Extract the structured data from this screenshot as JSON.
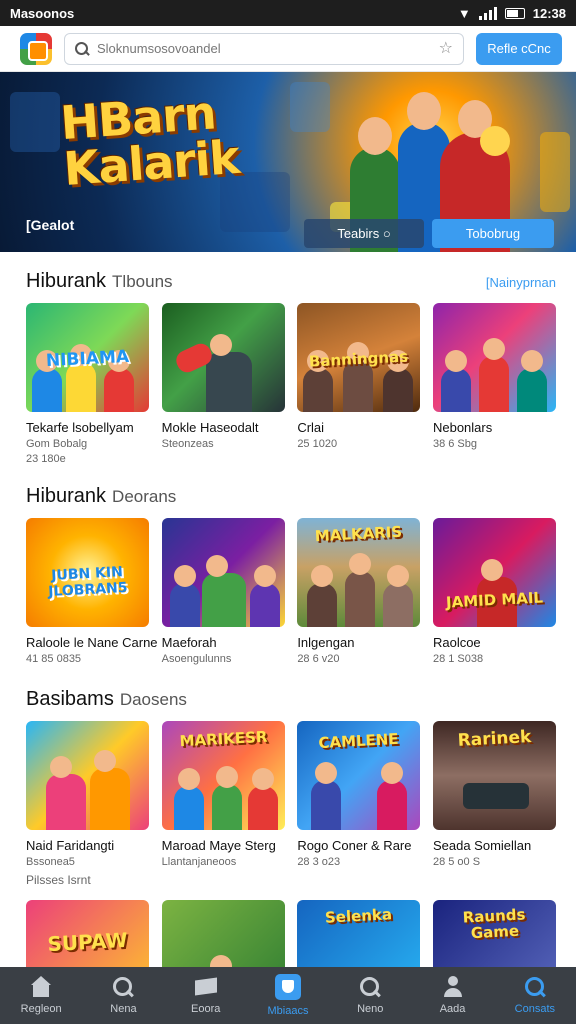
{
  "status_bar": {
    "carrier": "Masoonos",
    "time": "12:38"
  },
  "header": {
    "search_placeholder": "Sloknumsosovoandel",
    "action_button": "Refle cCnc"
  },
  "hero": {
    "title": "HBarn\nKalarik",
    "caption": "[Gealot",
    "secondary_button": "Teabirs ○",
    "primary_button": "Tobobrug"
  },
  "sections": [
    {
      "title": "Hiburank",
      "subtitle": "Tlbouns",
      "link": "[Nainyprnan",
      "items": [
        {
          "title": "Tekarfe lsobellyam",
          "meta": "Gom Bobalg",
          "meta2": "23 180e",
          "art": "NIBIAMA"
        },
        {
          "title": "Mokle Haseodalt",
          "meta": "Steonzeas",
          "meta2": "",
          "art": ""
        },
        {
          "title": "Crlai",
          "meta": "25 1020",
          "meta2": "",
          "art": "Banningnas"
        },
        {
          "title": "Nebonlars",
          "meta": "38 6 Sbg",
          "meta2": "",
          "art": ""
        }
      ]
    },
    {
      "title": "Hiburank",
      "subtitle": "Deorans",
      "link": "",
      "items": [
        {
          "title": "Raloole le Nane Carne",
          "meta": "41 85 0835",
          "meta2": "",
          "art": "JUBN KIN JLOBRAN5"
        },
        {
          "title": "Maeforah",
          "meta": "Asoengulunns",
          "meta2": "",
          "art": ""
        },
        {
          "title": "Inlgengan",
          "meta": "28 6 v20",
          "meta2": "",
          "art": "MALKARIS"
        },
        {
          "title": "Raolcoe",
          "meta": "28 1 S038",
          "meta2": "",
          "art": "JAMID MAIL"
        }
      ]
    },
    {
      "title": "Basibams",
      "subtitle": "Daosens",
      "link": "",
      "items": [
        {
          "title": "Naid Faridangti",
          "meta": "Bssonea5",
          "meta2": "",
          "art": ""
        },
        {
          "title": "Maroad Maye Sterg",
          "meta": "Llantanjaneoos",
          "meta2": "",
          "art": "MARIKESR"
        },
        {
          "title": "Rogo Coner & Rare",
          "meta": "28 3 o23",
          "meta2": "",
          "art": "CAMLENE"
        },
        {
          "title": "Seada Somiellan",
          "meta": "28 5 o0 S",
          "meta2": "",
          "art": "Rarinek"
        }
      ]
    }
  ],
  "mini_label": "Pilsses Isrnt",
  "peek_row": [
    {
      "art": "SUPAW"
    },
    {
      "art": ""
    },
    {
      "art": "Selenka"
    },
    {
      "art": "Raunds Game"
    }
  ],
  "bottom_nav": [
    {
      "label": "Regleon",
      "icon": "home-icon"
    },
    {
      "label": "Nena",
      "icon": "search-icon"
    },
    {
      "label": "Eoora",
      "icon": "flag-icon"
    },
    {
      "label": "Mbiaacs",
      "icon": "shield-icon",
      "active": true
    },
    {
      "label": "Neno",
      "icon": "search-icon"
    },
    {
      "label": "Aada",
      "icon": "user-icon"
    },
    {
      "label": "Consats",
      "icon": "search-icon"
    }
  ],
  "colors": {
    "accent": "#3b9cf0",
    "nav_bg": "#3a3f45",
    "status_bg": "#1e1e1e"
  }
}
